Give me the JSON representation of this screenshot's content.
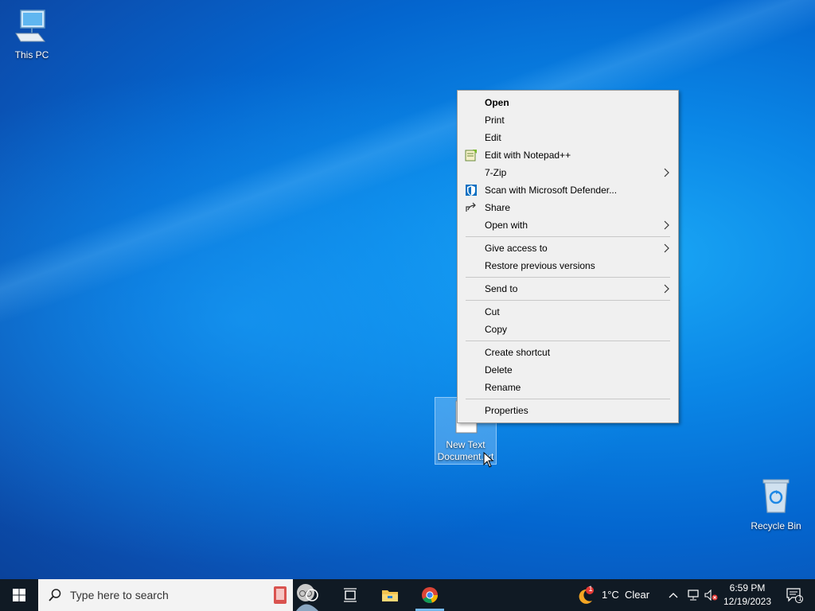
{
  "desktop": {
    "icons": [
      {
        "label": "This PC"
      },
      {
        "label": "New Text\nDocument.txt"
      },
      {
        "label": "Recycle Bin"
      }
    ]
  },
  "context_menu": {
    "items": [
      {
        "label": "Open"
      },
      {
        "label": "Print"
      },
      {
        "label": "Edit"
      },
      {
        "label": "Edit with Notepad++"
      },
      {
        "label": "7-Zip"
      },
      {
        "label": "Scan with Microsoft Defender..."
      },
      {
        "label": "Share"
      },
      {
        "label": "Open with"
      },
      {
        "label": "Give access to"
      },
      {
        "label": "Restore previous versions"
      },
      {
        "label": "Send to"
      },
      {
        "label": "Cut"
      },
      {
        "label": "Copy"
      },
      {
        "label": "Create shortcut"
      },
      {
        "label": "Delete"
      },
      {
        "label": "Rename"
      },
      {
        "label": "Properties"
      }
    ]
  },
  "taskbar": {
    "search_placeholder": "Type here to search",
    "weather": {
      "temp": "1°C",
      "condition": "Clear",
      "badge": "1"
    },
    "clock": {
      "time": "6:59 PM",
      "date": "12/19/2023"
    },
    "notifications_count": "1"
  },
  "colors": {
    "accent": "#0078d7",
    "taskbar": "#101a24",
    "menu_bg": "#f0f0f0"
  }
}
